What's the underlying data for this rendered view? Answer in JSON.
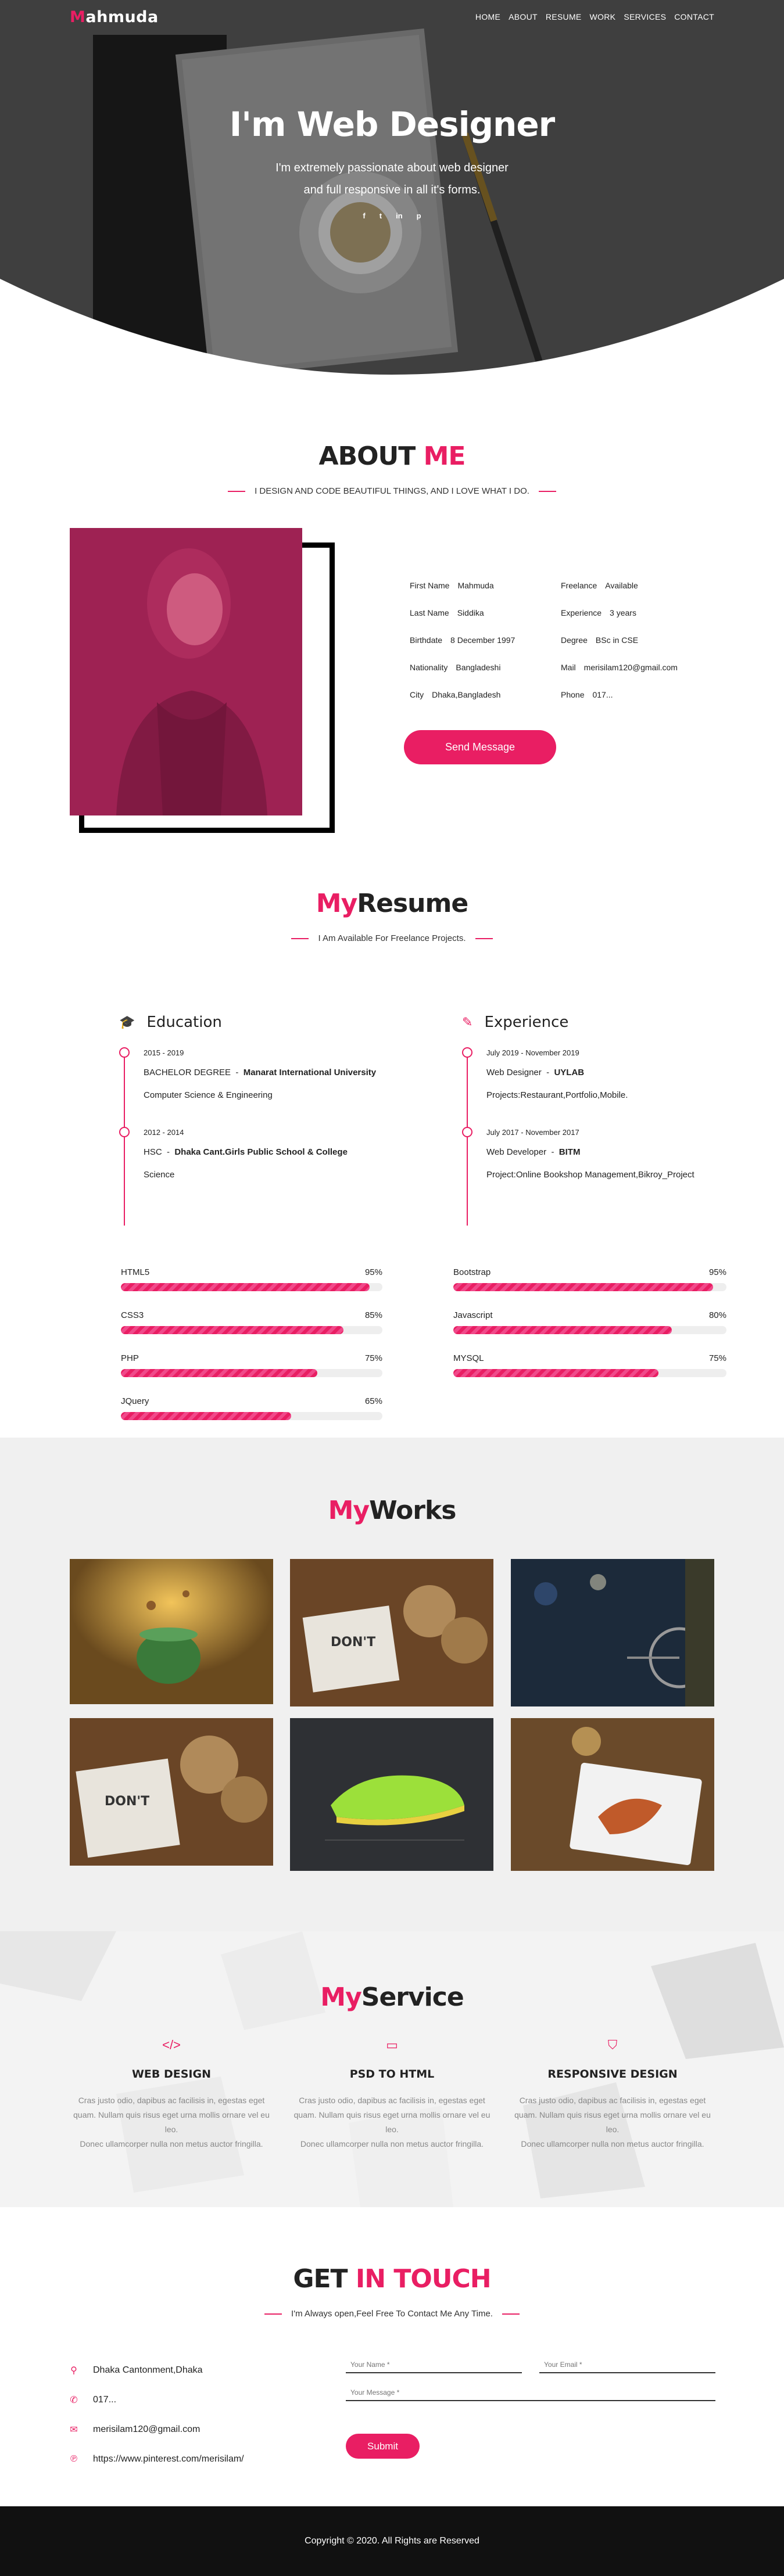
{
  "nav": {
    "logo_first": "M",
    "logo_rest": "ahmuda",
    "items": [
      "HOME",
      "ABOUT",
      "RESUME",
      "WORK",
      "SERVICES",
      "CONTACT"
    ]
  },
  "hero": {
    "title": "I'm Web Designer",
    "subtitle_line1": "I'm extremely passionate about web designer",
    "subtitle_line2": "and full responsive in all it's forms.",
    "social": [
      "f",
      "t",
      "in",
      "p"
    ]
  },
  "about": {
    "title_a": "ABOUT",
    "title_b": "ME",
    "tagline": "I DESIGN AND CODE BEAUTIFUL THINGS, AND I LOVE WHAT I DO.",
    "info_left": [
      {
        "label": "First Name",
        "value": "Mahmuda"
      },
      {
        "label": "Last Name",
        "value": "Siddika"
      },
      {
        "label": "Birthdate",
        "value": "8 December 1997"
      },
      {
        "label": "Nationality",
        "value": "Bangladeshi"
      },
      {
        "label": "City",
        "value": "Dhaka,Bangladesh"
      }
    ],
    "info_right": [
      {
        "label": "Freelance",
        "value": "Available"
      },
      {
        "label": "Experience",
        "value": "3 years"
      },
      {
        "label": "Degree",
        "value": "BSc in CSE"
      },
      {
        "label": "Mail",
        "value": "merisilam120@gmail.com"
      },
      {
        "label": "Phone",
        "value": "017..."
      }
    ],
    "button": "Send Message"
  },
  "resume": {
    "title_a": "My",
    "title_b": "Resume",
    "tagline": "I Am Available For Freelance Projects.",
    "education": {
      "heading": "Education",
      "items": [
        {
          "date": "2015 - 2019",
          "role": "BACHELOR DEGREE",
          "org": "Manarat International University",
          "desc": "Computer Science & Engineering"
        },
        {
          "date": "2012 - 2014",
          "role": "HSC",
          "org": "Dhaka Cant.Girls Public School & College",
          "desc": "Science"
        }
      ]
    },
    "experience": {
      "heading": "Experience",
      "items": [
        {
          "date": "July 2019 - November 2019",
          "role": "Web Designer",
          "org": "UYLAB",
          "desc": "Projects:Restaurant,Portfolio,Mobile."
        },
        {
          "date": "July 2017 - November 2017",
          "role": "Web Developer",
          "org": "BITM",
          "desc": "Project:Online Bookshop Management,Bikroy_Project"
        }
      ]
    },
    "skills_left": [
      {
        "name": "HTML5",
        "label": "95%",
        "value": 0.95
      },
      {
        "name": "CSS3",
        "label": "85%",
        "value": 0.85
      },
      {
        "name": "PHP",
        "label": "75%",
        "value": 0.75
      },
      {
        "name": "JQuery",
        "label": "65%",
        "value": 0.65
      }
    ],
    "skills_right": [
      {
        "name": "Bootstrap",
        "label": "95%",
        "value": 0.95
      },
      {
        "name": "Javascript",
        "label": "80%",
        "value": 0.8
      },
      {
        "name": "MYSQL",
        "label": "75%",
        "value": 0.75
      }
    ]
  },
  "works": {
    "title_a": "My",
    "title_b": "Works"
  },
  "service": {
    "title_a": "My",
    "title_b": "Service",
    "items": [
      {
        "icon": "code-icon",
        "title": "WEB DESIGN",
        "line1": "Cras justo odio, dapibus ac facilisis in, egestas eget",
        "line2": "quam. Nullam quis risus eget urna mollis ornare vel eu leo.",
        "line3": "Donec ullamcorper nulla non metus auctor fringilla."
      },
      {
        "icon": "monitor-icon",
        "title": "PSD TO HTML",
        "line1": "Cras justo odio, dapibus ac facilisis in, egestas eget",
        "line2": "quam. Nullam quis risus eget urna mollis ornare vel eu leo.",
        "line3": "Donec ullamcorper nulla non metus auctor fringilla."
      },
      {
        "icon": "html5-icon",
        "title": "RESPONSIVE DESIGN",
        "line1": "Cras justo odio, dapibus ac facilisis in, egestas eget",
        "line2": "quam. Nullam quis risus eget urna mollis ornare vel eu leo.",
        "line3": "Donec ullamcorper nulla non metus auctor fringilla."
      }
    ]
  },
  "contact": {
    "title_a": "GET",
    "title_b": "IN TOUCH",
    "tagline": "I'm Always open,Feel Free To Contact Me Any Time.",
    "address": "Dhaka Cantonment,Dhaka",
    "phone": "017...",
    "email": "merisilam120@gmail.com",
    "pinterest": "https://www.pinterest.com/merisilam/",
    "name_placeholder": "Your Name *",
    "email_placeholder": "Your Email *",
    "message_placeholder": "Your Message *",
    "submit": "Submit"
  },
  "footer": {
    "text": "Copyright © 2020. All Rights are Reserved"
  },
  "colors": {
    "accent": "#e91e63",
    "footer": "#111111",
    "works_bg": "#f0f0f0"
  }
}
